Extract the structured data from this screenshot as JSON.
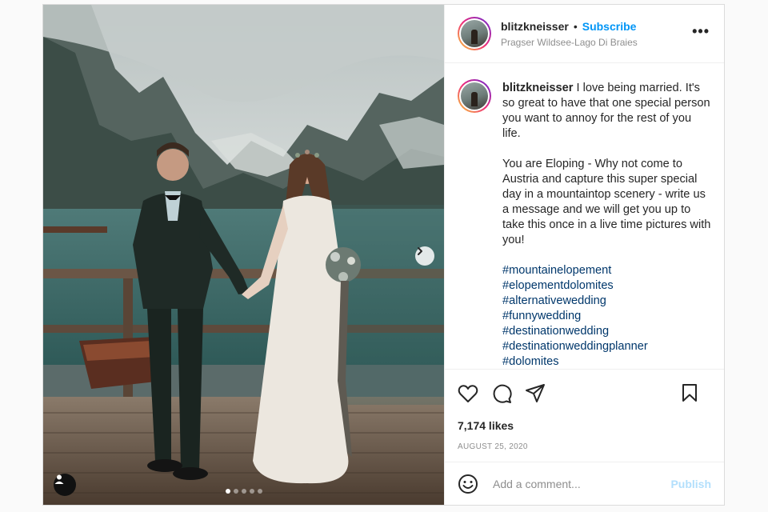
{
  "post": {
    "username": "blitzkneisser",
    "subscribe_label": "Subscribe",
    "location": "Pragser Wildsee-Lago Di Braies",
    "more_label": "•••",
    "caption": {
      "username": "blitzkneisser",
      "paragraph1": "I love being married. It's so great to have that one special person you want to annoy for the rest of you life.",
      "paragraph2": "You are Eloping - Why not come to Austria and capture this super special day in a mountaintop scenery - write us a message and we will get you up to take this once in a live time pictures with you!",
      "hashtags": [
        "#mountainelopement",
        "#elopementdolomites",
        "#alternativewedding",
        "#funnywedding",
        "#destinationwedding",
        "#destinationweddingplanner",
        "#dolomites"
      ]
    },
    "likes": "7,174 likes",
    "date": "AUGUST 25, 2020",
    "comment": {
      "placeholder": "Add a comment...",
      "publish_label": "Publish"
    },
    "carousel": {
      "total": 5,
      "active": 0
    }
  },
  "icons": [
    "heart-icon",
    "comment-icon",
    "share-icon",
    "bookmark-icon",
    "emoji-icon",
    "chevron-right-icon",
    "user-tag-icon",
    "more-icon"
  ],
  "colors": {
    "accent": "#0095f6",
    "hashtag": "#00376b",
    "publish_disabled": "#b2dffc",
    "muted": "#8e8e8e"
  }
}
